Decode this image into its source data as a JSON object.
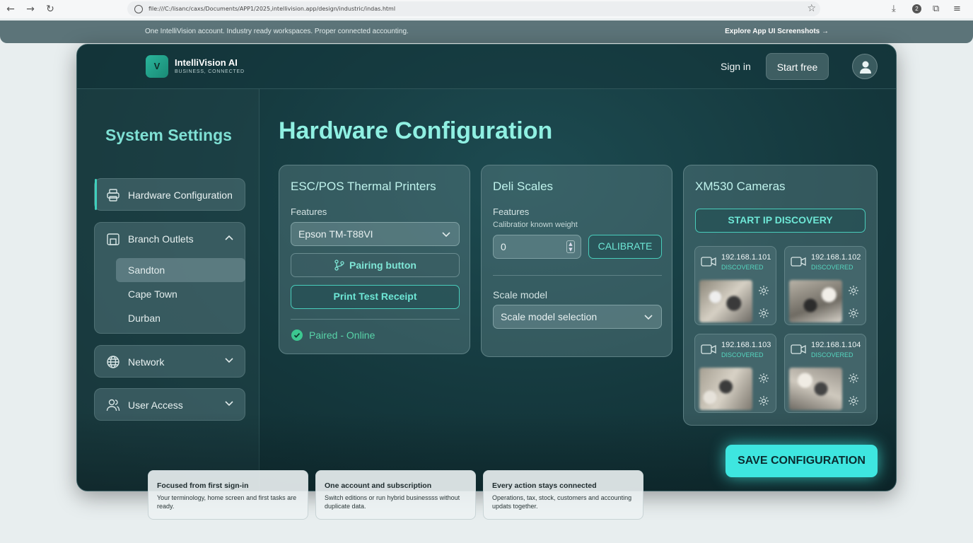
{
  "browser": {
    "url": "file:///C:/lisanc/caxs/Documents/APP1/2025,intellivision.app/design/industric/indas.html",
    "back_icon": "←",
    "forward_icon": "→",
    "reload_icon": "↻",
    "star_icon": "☆",
    "download_icon": "⤓",
    "badge_count": "2",
    "extensions_icon": "⧉",
    "menu_icon": "≡"
  },
  "announcement": {
    "text": "One IntelliVision account. Industry ready workspaces. Proper connected accounting.",
    "link": "Explore App UI Screenshots →"
  },
  "header": {
    "logo_letter": "V",
    "brand": "IntelliVision AI",
    "tagline": "BUSINESS, CONNECTED",
    "sign_in": "Sign in",
    "start_free": "Start free"
  },
  "sidebar": {
    "title": "System Settings",
    "items": {
      "hardware": "Hardware Configuration",
      "branches": "Branch Outlets",
      "network": "Network",
      "users": "User Access"
    },
    "branch_list": [
      "Sandton",
      "Cape Town",
      "Durban"
    ]
  },
  "main": {
    "title": "Hardware Configuration",
    "printers": {
      "title": "ESC/POS Thermal Printers",
      "features_label": "Features",
      "model": "Epson TM-T88VI",
      "pairing": "Pairing button",
      "test": "Print Test Receipt",
      "status": "Paired - Online"
    },
    "scales": {
      "title": "Deli Scales",
      "features_label": "Features",
      "calib_label": "Calibratior known weight",
      "calib_value": "0",
      "calibrate": "CALIBRATE",
      "model_label": "Scale model",
      "model_placeholder": "Scale model selection"
    },
    "cameras": {
      "title": "XM530 Cameras",
      "discover": "START IP DISCOVERY",
      "list": [
        {
          "ip": "192.168.1.101",
          "status": "DISCOVERED"
        },
        {
          "ip": "192.168.1.102",
          "status": "DISCOVERED"
        },
        {
          "ip": "192.168.1.103",
          "status": "DISCOVERED"
        },
        {
          "ip": "192.168.1.104",
          "status": "DISCOVERED"
        }
      ]
    },
    "save": "SAVE CONFIGURATION"
  },
  "features": [
    {
      "title": "Focused from first sign-in",
      "desc": "Your terminology, home screen and first tasks are ready."
    },
    {
      "title": "One account and subscription",
      "desc": "Switch editions or run hybrid businessss without duplicate data."
    },
    {
      "title": "Every action stays connected",
      "desc": "Operations, tax, stock, customers and accounting updats together."
    }
  ],
  "colors": {
    "accent": "#3fd0bd",
    "title": "#8ff0e2",
    "save": "#3ee6e0",
    "online": "#3cc890"
  }
}
